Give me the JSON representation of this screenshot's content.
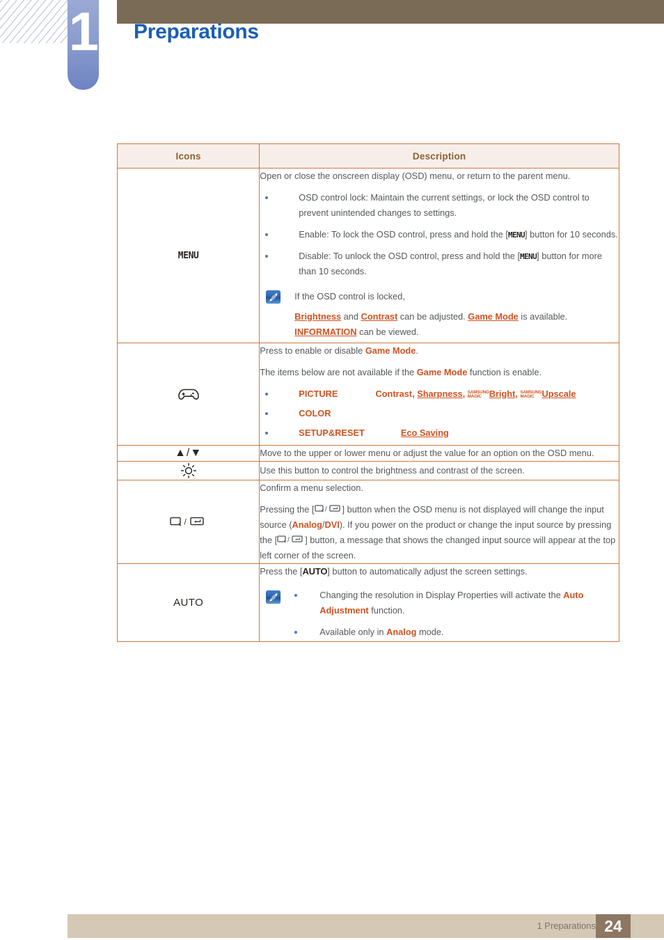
{
  "header": {
    "chapter_number": "1",
    "chapter_title": "Preparations",
    "band_color": "#7a6b57",
    "tab_color": "#8b9dce",
    "title_color": "#1a5fb4"
  },
  "table": {
    "border_color": "#c9793f",
    "header_bg": "#f8eee9",
    "header_text_color": "#8a6331",
    "columns": [
      "Icons",
      "Description"
    ],
    "rows": [
      {
        "icon_label": "MENU",
        "icon_name": "menu-button-glyph",
        "intro": "Open or close the onscreen display (OSD) menu, or return to the parent menu.",
        "bullets": [
          "OSD control lock: Maintain the current settings, or lock the OSD control to prevent unintended changes to settings.",
          "Enable: To lock the OSD control, press and hold the [MENU] button for 10 seconds.",
          "Disable: To unlock the OSD control, press and hold the [MENU] button for more than 10 seconds."
        ],
        "note": {
          "line1": "If the OSD control is locked,",
          "line2_terms": [
            "Brightness",
            "Contrast",
            "Game Mode",
            "INFORMATION"
          ],
          "line2": "Brightness and Contrast can be adjusted. Game Mode is available. INFORMATION can be viewed."
        }
      },
      {
        "icon_name": "gamepad-icon",
        "line1_prefix": "Press to enable or disable ",
        "line1_term": "Game Mode",
        "line1_suffix": ".",
        "line2_prefix": "The items below are not available if the ",
        "line2_term": "Game Mode",
        "line2_suffix": " function is enable.",
        "menu_items": [
          {
            "menu": "PICTURE",
            "options": [
              "Contrast",
              "Sharpness",
              "Bright",
              "Upscale"
            ],
            "magic_prefix": "SAMSUNG",
            "magic_suffix": "MAGIC"
          },
          {
            "menu": "COLOR",
            "options": []
          },
          {
            "menu": "SETUP&RESET",
            "options": [
              "Eco Saving"
            ]
          }
        ]
      },
      {
        "icon_label": "▲/▼",
        "icon_name": "up-down-arrow-icon",
        "text": "Move to the upper or lower menu or adjust the value for an option on the OSD menu."
      },
      {
        "icon_name": "brightness-sun-icon",
        "text": "Use this button to control the brightness and contrast of the screen."
      },
      {
        "icon_name": "source-enter-icon",
        "line1": "Confirm a menu selection.",
        "para_a": "Pressing the [",
        "para_b": "] button when the OSD menu is not displayed will change the input source (",
        "source_1": "Analog",
        "source_sep": "/",
        "source_2": "DVI",
        "para_c": "). If you power on the product or change the input source by pressing the [",
        "para_d": "] button, a message that shows the changed input source will appear at the top left corner of the screen."
      },
      {
        "icon_label": "AUTO",
        "icon_name": "auto-button-glyph",
        "line1_a": "Press the [",
        "line1_key": "AUTO",
        "line1_b": "] button to automatically adjust the screen settings.",
        "note_bullets": [
          {
            "prefix": "Changing the resolution in Display Properties will activate the ",
            "term": "Auto Adjustment",
            "suffix": " function."
          },
          {
            "prefix": "Available only in ",
            "term": "Analog",
            "suffix": " mode."
          }
        ]
      }
    ]
  },
  "footer": {
    "label": "1 Preparations",
    "page_number": "24",
    "bar_color": "#d5c8b4",
    "page_box_color": "#8c7763"
  }
}
